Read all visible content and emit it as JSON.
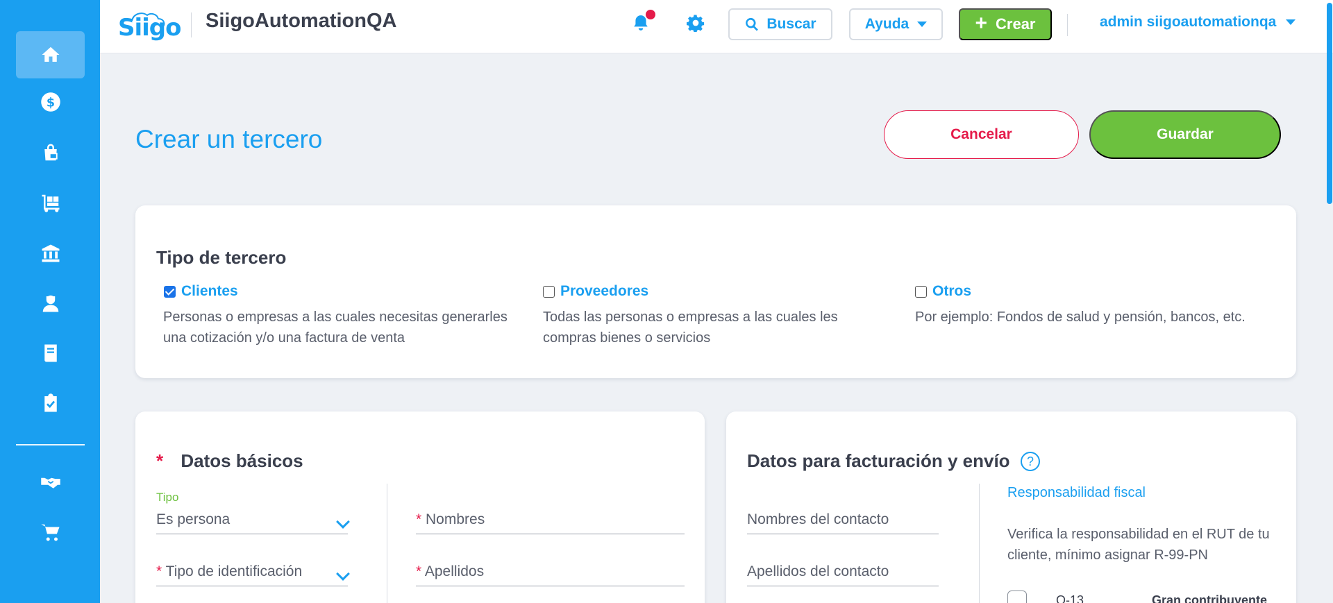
{
  "colors": {
    "primary": "#1a9ff0",
    "success": "#6cc13e",
    "danger": "#e51b4a",
    "text": "#3a3f4d"
  },
  "sidebar": {
    "items": [
      {
        "name": "home-icon",
        "active": true
      },
      {
        "name": "dollar-icon"
      },
      {
        "name": "shopping-bag-icon"
      },
      {
        "name": "dolly-icon"
      },
      {
        "name": "bank-icon"
      },
      {
        "name": "user-tie-icon"
      },
      {
        "name": "book-icon"
      },
      {
        "name": "clipboard-check-icon"
      },
      {
        "name": "handshake-icon"
      },
      {
        "name": "cart-icon"
      }
    ]
  },
  "header": {
    "logo": "Siigo",
    "company": "SiigoAutomationQA",
    "search_label": "Buscar",
    "help_label": "Ayuda",
    "create_label": "Crear",
    "user_label": "admin siigoautomationqa"
  },
  "page": {
    "title": "Crear un tercero",
    "cancel_label": "Cancelar",
    "save_label": "Guardar"
  },
  "tipo_tercero": {
    "title": "Tipo de tercero",
    "options": [
      {
        "label": "Clientes",
        "checked": true,
        "desc": "Personas o empresas a las cuales necesitas generarles una cotización y/o una factura de venta"
      },
      {
        "label": "Proveedores",
        "checked": false,
        "desc": "Todas las personas o empresas a las cuales les compras bienes o servicios"
      },
      {
        "label": "Otros",
        "checked": false,
        "desc": "Por ejemplo: Fondos de salud y pensión, bancos, etc."
      }
    ]
  },
  "datos_basicos": {
    "required_mark": "*",
    "title": "Datos básicos",
    "tipo_label": "Tipo",
    "tipo_value": "Es persona",
    "tipo_id_label": "Tipo de identificación",
    "nombres_label": "Nombres",
    "apellidos_label": "Apellidos"
  },
  "facturacion": {
    "title": "Datos para facturación y envío",
    "help": "?",
    "contact_names_label": "Nombres del contacto",
    "contact_lastnames_label": "Apellidos del contacto",
    "fiscal_title": "Responsabilidad fiscal",
    "fiscal_desc": "Verifica la responsabilidad en el RUT de tu cliente, mínimo asignar R-99-PN",
    "fiscal_row": {
      "code": "O-13",
      "label": "Gran contribuyente"
    }
  }
}
